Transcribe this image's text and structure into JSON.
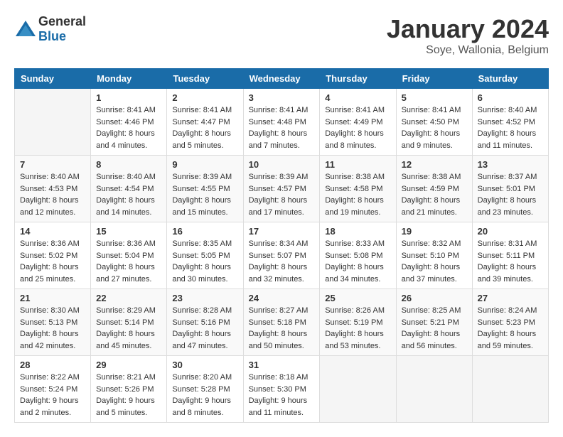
{
  "header": {
    "logo": {
      "general": "General",
      "blue": "Blue"
    },
    "title": "January 2024",
    "location": "Soye, Wallonia, Belgium"
  },
  "calendar": {
    "weekdays": [
      "Sunday",
      "Monday",
      "Tuesday",
      "Wednesday",
      "Thursday",
      "Friday",
      "Saturday"
    ],
    "weeks": [
      [
        {
          "day": "",
          "empty": true
        },
        {
          "day": "1",
          "sunrise": "Sunrise: 8:41 AM",
          "sunset": "Sunset: 4:46 PM",
          "daylight": "Daylight: 8 hours and 4 minutes."
        },
        {
          "day": "2",
          "sunrise": "Sunrise: 8:41 AM",
          "sunset": "Sunset: 4:47 PM",
          "daylight": "Daylight: 8 hours and 5 minutes."
        },
        {
          "day": "3",
          "sunrise": "Sunrise: 8:41 AM",
          "sunset": "Sunset: 4:48 PM",
          "daylight": "Daylight: 8 hours and 7 minutes."
        },
        {
          "day": "4",
          "sunrise": "Sunrise: 8:41 AM",
          "sunset": "Sunset: 4:49 PM",
          "daylight": "Daylight: 8 hours and 8 minutes."
        },
        {
          "day": "5",
          "sunrise": "Sunrise: 8:41 AM",
          "sunset": "Sunset: 4:50 PM",
          "daylight": "Daylight: 8 hours and 9 minutes."
        },
        {
          "day": "6",
          "sunrise": "Sunrise: 8:40 AM",
          "sunset": "Sunset: 4:52 PM",
          "daylight": "Daylight: 8 hours and 11 minutes."
        }
      ],
      [
        {
          "day": "7",
          "sunrise": "Sunrise: 8:40 AM",
          "sunset": "Sunset: 4:53 PM",
          "daylight": "Daylight: 8 hours and 12 minutes."
        },
        {
          "day": "8",
          "sunrise": "Sunrise: 8:40 AM",
          "sunset": "Sunset: 4:54 PM",
          "daylight": "Daylight: 8 hours and 14 minutes."
        },
        {
          "day": "9",
          "sunrise": "Sunrise: 8:39 AM",
          "sunset": "Sunset: 4:55 PM",
          "daylight": "Daylight: 8 hours and 15 minutes."
        },
        {
          "day": "10",
          "sunrise": "Sunrise: 8:39 AM",
          "sunset": "Sunset: 4:57 PM",
          "daylight": "Daylight: 8 hours and 17 minutes."
        },
        {
          "day": "11",
          "sunrise": "Sunrise: 8:38 AM",
          "sunset": "Sunset: 4:58 PM",
          "daylight": "Daylight: 8 hours and 19 minutes."
        },
        {
          "day": "12",
          "sunrise": "Sunrise: 8:38 AM",
          "sunset": "Sunset: 4:59 PM",
          "daylight": "Daylight: 8 hours and 21 minutes."
        },
        {
          "day": "13",
          "sunrise": "Sunrise: 8:37 AM",
          "sunset": "Sunset: 5:01 PM",
          "daylight": "Daylight: 8 hours and 23 minutes."
        }
      ],
      [
        {
          "day": "14",
          "sunrise": "Sunrise: 8:36 AM",
          "sunset": "Sunset: 5:02 PM",
          "daylight": "Daylight: 8 hours and 25 minutes."
        },
        {
          "day": "15",
          "sunrise": "Sunrise: 8:36 AM",
          "sunset": "Sunset: 5:04 PM",
          "daylight": "Daylight: 8 hours and 27 minutes."
        },
        {
          "day": "16",
          "sunrise": "Sunrise: 8:35 AM",
          "sunset": "Sunset: 5:05 PM",
          "daylight": "Daylight: 8 hours and 30 minutes."
        },
        {
          "day": "17",
          "sunrise": "Sunrise: 8:34 AM",
          "sunset": "Sunset: 5:07 PM",
          "daylight": "Daylight: 8 hours and 32 minutes."
        },
        {
          "day": "18",
          "sunrise": "Sunrise: 8:33 AM",
          "sunset": "Sunset: 5:08 PM",
          "daylight": "Daylight: 8 hours and 34 minutes."
        },
        {
          "day": "19",
          "sunrise": "Sunrise: 8:32 AM",
          "sunset": "Sunset: 5:10 PM",
          "daylight": "Daylight: 8 hours and 37 minutes."
        },
        {
          "day": "20",
          "sunrise": "Sunrise: 8:31 AM",
          "sunset": "Sunset: 5:11 PM",
          "daylight": "Daylight: 8 hours and 39 minutes."
        }
      ],
      [
        {
          "day": "21",
          "sunrise": "Sunrise: 8:30 AM",
          "sunset": "Sunset: 5:13 PM",
          "daylight": "Daylight: 8 hours and 42 minutes."
        },
        {
          "day": "22",
          "sunrise": "Sunrise: 8:29 AM",
          "sunset": "Sunset: 5:14 PM",
          "daylight": "Daylight: 8 hours and 45 minutes."
        },
        {
          "day": "23",
          "sunrise": "Sunrise: 8:28 AM",
          "sunset": "Sunset: 5:16 PM",
          "daylight": "Daylight: 8 hours and 47 minutes."
        },
        {
          "day": "24",
          "sunrise": "Sunrise: 8:27 AM",
          "sunset": "Sunset: 5:18 PM",
          "daylight": "Daylight: 8 hours and 50 minutes."
        },
        {
          "day": "25",
          "sunrise": "Sunrise: 8:26 AM",
          "sunset": "Sunset: 5:19 PM",
          "daylight": "Daylight: 8 hours and 53 minutes."
        },
        {
          "day": "26",
          "sunrise": "Sunrise: 8:25 AM",
          "sunset": "Sunset: 5:21 PM",
          "daylight": "Daylight: 8 hours and 56 minutes."
        },
        {
          "day": "27",
          "sunrise": "Sunrise: 8:24 AM",
          "sunset": "Sunset: 5:23 PM",
          "daylight": "Daylight: 8 hours and 59 minutes."
        }
      ],
      [
        {
          "day": "28",
          "sunrise": "Sunrise: 8:22 AM",
          "sunset": "Sunset: 5:24 PM",
          "daylight": "Daylight: 9 hours and 2 minutes."
        },
        {
          "day": "29",
          "sunrise": "Sunrise: 8:21 AM",
          "sunset": "Sunset: 5:26 PM",
          "daylight": "Daylight: 9 hours and 5 minutes."
        },
        {
          "day": "30",
          "sunrise": "Sunrise: 8:20 AM",
          "sunset": "Sunset: 5:28 PM",
          "daylight": "Daylight: 9 hours and 8 minutes."
        },
        {
          "day": "31",
          "sunrise": "Sunrise: 8:18 AM",
          "sunset": "Sunset: 5:30 PM",
          "daylight": "Daylight: 9 hours and 11 minutes."
        },
        {
          "day": "",
          "empty": true
        },
        {
          "day": "",
          "empty": true
        },
        {
          "day": "",
          "empty": true
        }
      ]
    ]
  }
}
